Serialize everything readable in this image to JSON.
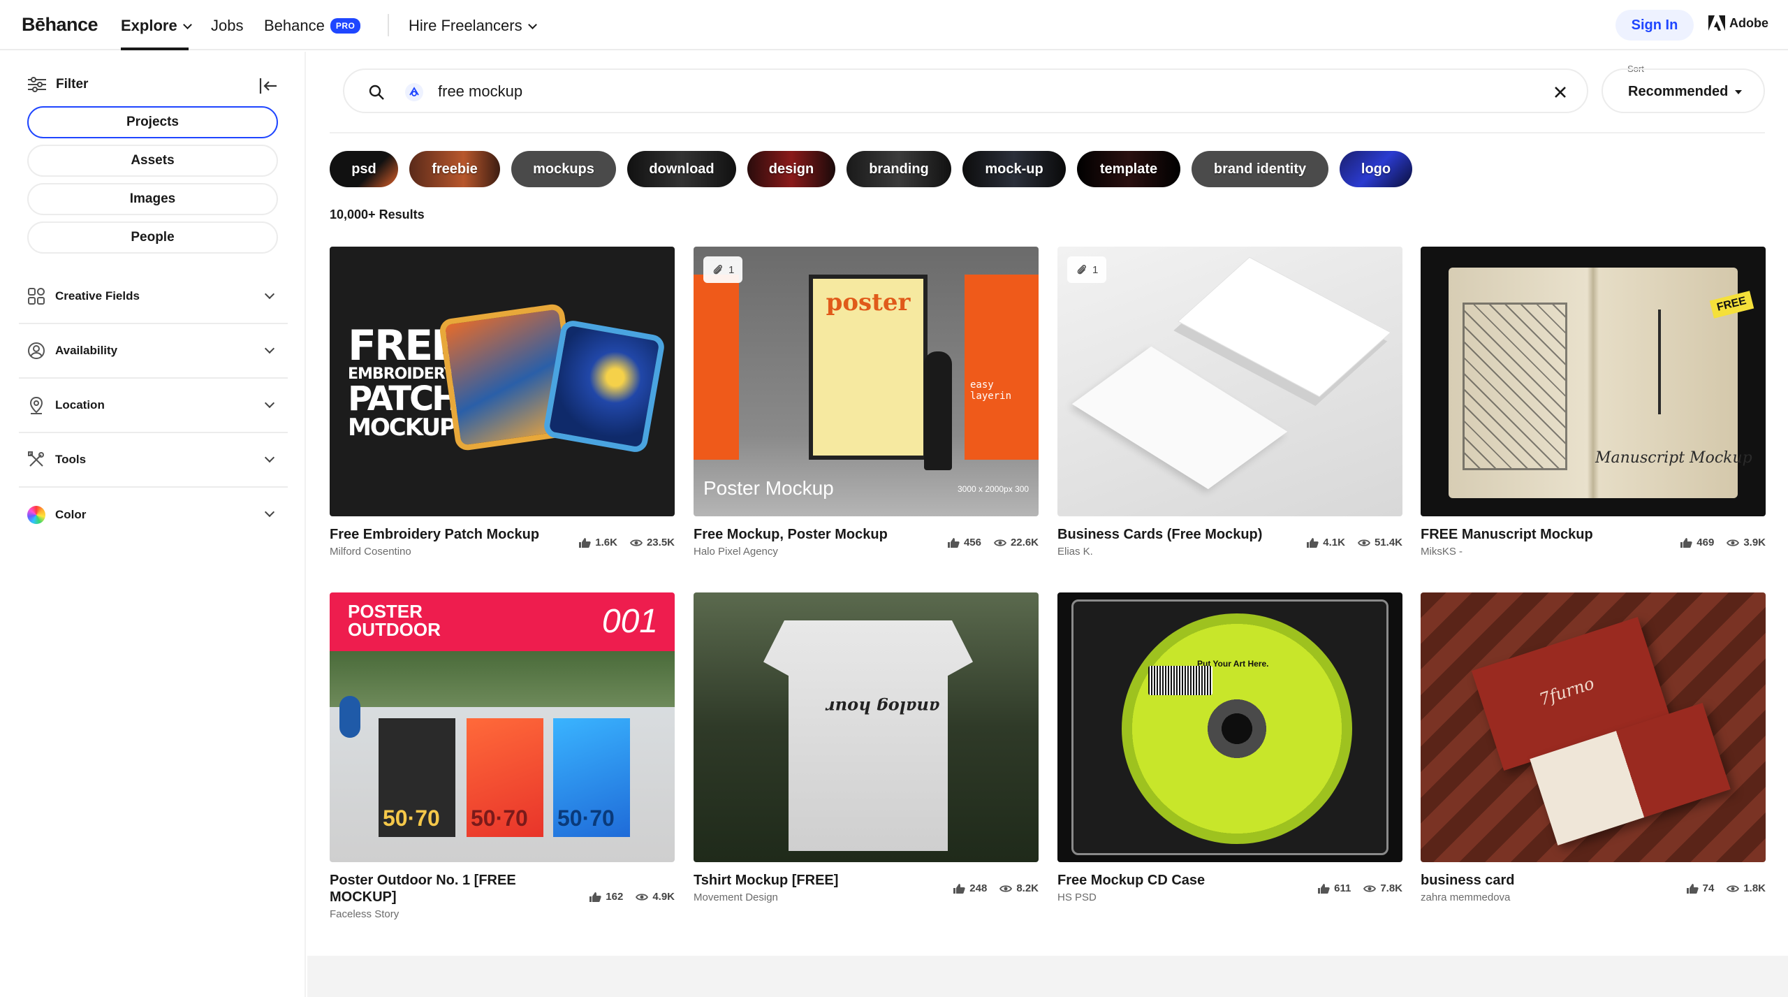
{
  "header": {
    "logo": "Bēhance",
    "nav": {
      "explore": "Explore",
      "jobs": "Jobs",
      "behance": "Behance",
      "pro_badge": "PRO",
      "hire": "Hire Freelancers"
    },
    "sign_in": "Sign In",
    "adobe": "Adobe"
  },
  "sidebar": {
    "filter_label": "Filter",
    "tabs": [
      {
        "label": "Projects",
        "active": true
      },
      {
        "label": "Assets",
        "active": false
      },
      {
        "label": "Images",
        "active": false
      },
      {
        "label": "People",
        "active": false
      }
    ],
    "sections": [
      {
        "label": "Creative Fields",
        "icon": "grid-icon"
      },
      {
        "label": "Availability",
        "icon": "availability-icon"
      },
      {
        "label": "Location",
        "icon": "location-pin-icon"
      },
      {
        "label": "Tools",
        "icon": "tools-icon"
      },
      {
        "label": "Color",
        "icon": "color-wheel-icon"
      }
    ]
  },
  "search": {
    "query": "free mockup",
    "sort_label": "Sort",
    "sort_value": "Recommended"
  },
  "chips": [
    "psd",
    "freebie",
    "mockups",
    "download",
    "design",
    "branding",
    "mock-up",
    "template",
    "brand identity",
    "logo"
  ],
  "results_count": "10,000+ Results",
  "projects": [
    {
      "title": "Free Embroidery Patch Mockup",
      "author": "Milford Cosentino",
      "likes": "1.6K",
      "views": "23.5K",
      "attachments": null
    },
    {
      "title": "Free Mockup, Poster Mockup",
      "author": "Halo Pixel Agency",
      "likes": "456",
      "views": "22.6K",
      "attachments": "1"
    },
    {
      "title": "Business Cards (Free Mockup)",
      "author": "Elias K.",
      "likes": "4.1K",
      "views": "51.4K",
      "attachments": "1"
    },
    {
      "title": "FREE Manuscript Mockup",
      "author": "MiksKS -",
      "likes": "469",
      "views": "3.9K",
      "attachments": null
    },
    {
      "title": "Poster Outdoor No. 1 [FREE MOCKUP]",
      "author": "Faceless Story",
      "likes": "162",
      "views": "4.9K",
      "attachments": null
    },
    {
      "title": "Tshirt Mockup [FREE]",
      "author": "Movement Design",
      "likes": "248",
      "views": "8.2K",
      "attachments": null
    },
    {
      "title": "Free Mockup CD Case",
      "author": "HS PSD",
      "likes": "611",
      "views": "7.8K",
      "attachments": null
    },
    {
      "title": "business card",
      "author": "zahra memmedova",
      "likes": "74",
      "views": "1.8K",
      "attachments": null
    }
  ],
  "thumb_text": {
    "patch_line1": "FREE",
    "patch_line2": "EMBROIDERY",
    "patch_line3": "PATCH",
    "patch_line4": "MOCKUP",
    "poster_word": "poster",
    "poster_caption": "Poster Mockup",
    "poster_dims": "3000 x 2000px 300",
    "poster_side": "easy layerin",
    "free_sticker": "FREE",
    "manuscript_word": "Manuscript Mockup",
    "outdoor_title1": "POSTER",
    "outdoor_title2": "OUTDOOR",
    "outdoor_num": "001",
    "outdoor_poster_num": "50·70",
    "tshirt_word": "analog hour",
    "cd_text": "Put Your Art Here.",
    "card_brand": "7furno"
  }
}
